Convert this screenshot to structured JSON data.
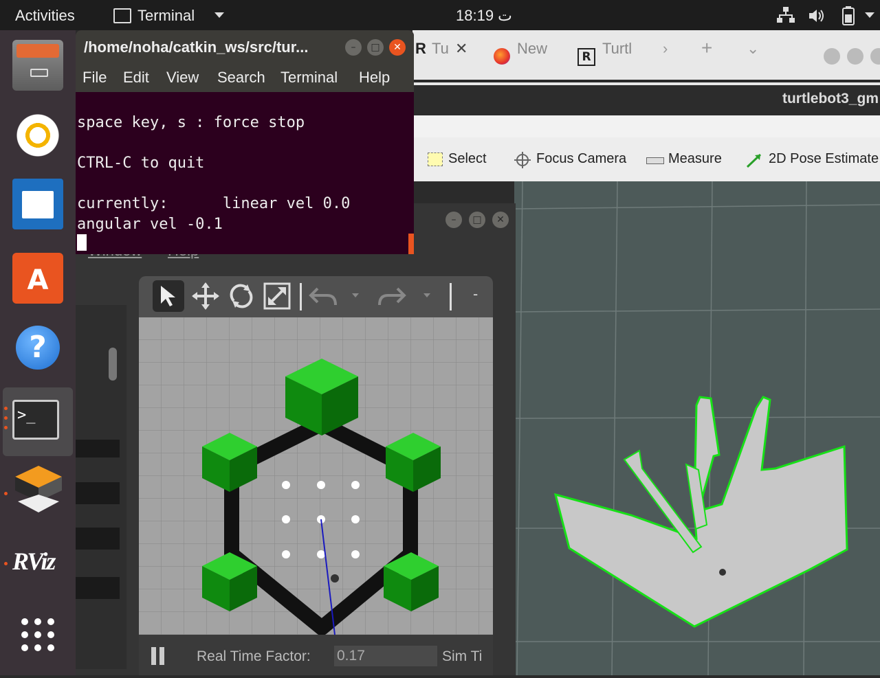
{
  "topbar": {
    "activities": "Activities",
    "app_name": "Terminal",
    "clock": "18:19 ت"
  },
  "terminal": {
    "title": "/home/noha/catkin_ws/src/tur...",
    "menu": [
      "File",
      "Edit",
      "View",
      "Search",
      "Terminal",
      "Help"
    ],
    "lines": [
      "space key, s : force stop",
      "CTRL-C to quit",
      "currently:      linear vel 0.0",
      "angular vel -0.1"
    ]
  },
  "browser": {
    "tabs": [
      "Tu",
      "New",
      "Turtl"
    ]
  },
  "rviz": {
    "window_title": "turtlebot3_gm",
    "tools": {
      "select": "Select",
      "focus_camera": "Focus Camera",
      "measure": "Measure",
      "pose_estimate": "2D Pose Estimate"
    }
  },
  "gazebo": {
    "menu_partial": [
      "Window",
      "Help"
    ],
    "real_time_factor_label": "Real Time Factor:",
    "real_time_factor_value": "0.17",
    "sim_time_label": "Sim Ti"
  },
  "dock": {
    "items": [
      "files-icon",
      "rhythmbox-icon",
      "writer-icon",
      "software-center-icon",
      "help-icon",
      "terminal-icon",
      "gazebo-icon",
      "rviz-icon",
      "app-grid-icon"
    ],
    "rviz_label": "RViz"
  },
  "colors": {
    "terminal_bg": "#2c001e",
    "accent_orange": "#e95420",
    "map_free": "#c8c8c8",
    "map_edge": "#17e017",
    "rviz_bg": "#4d5a59"
  }
}
